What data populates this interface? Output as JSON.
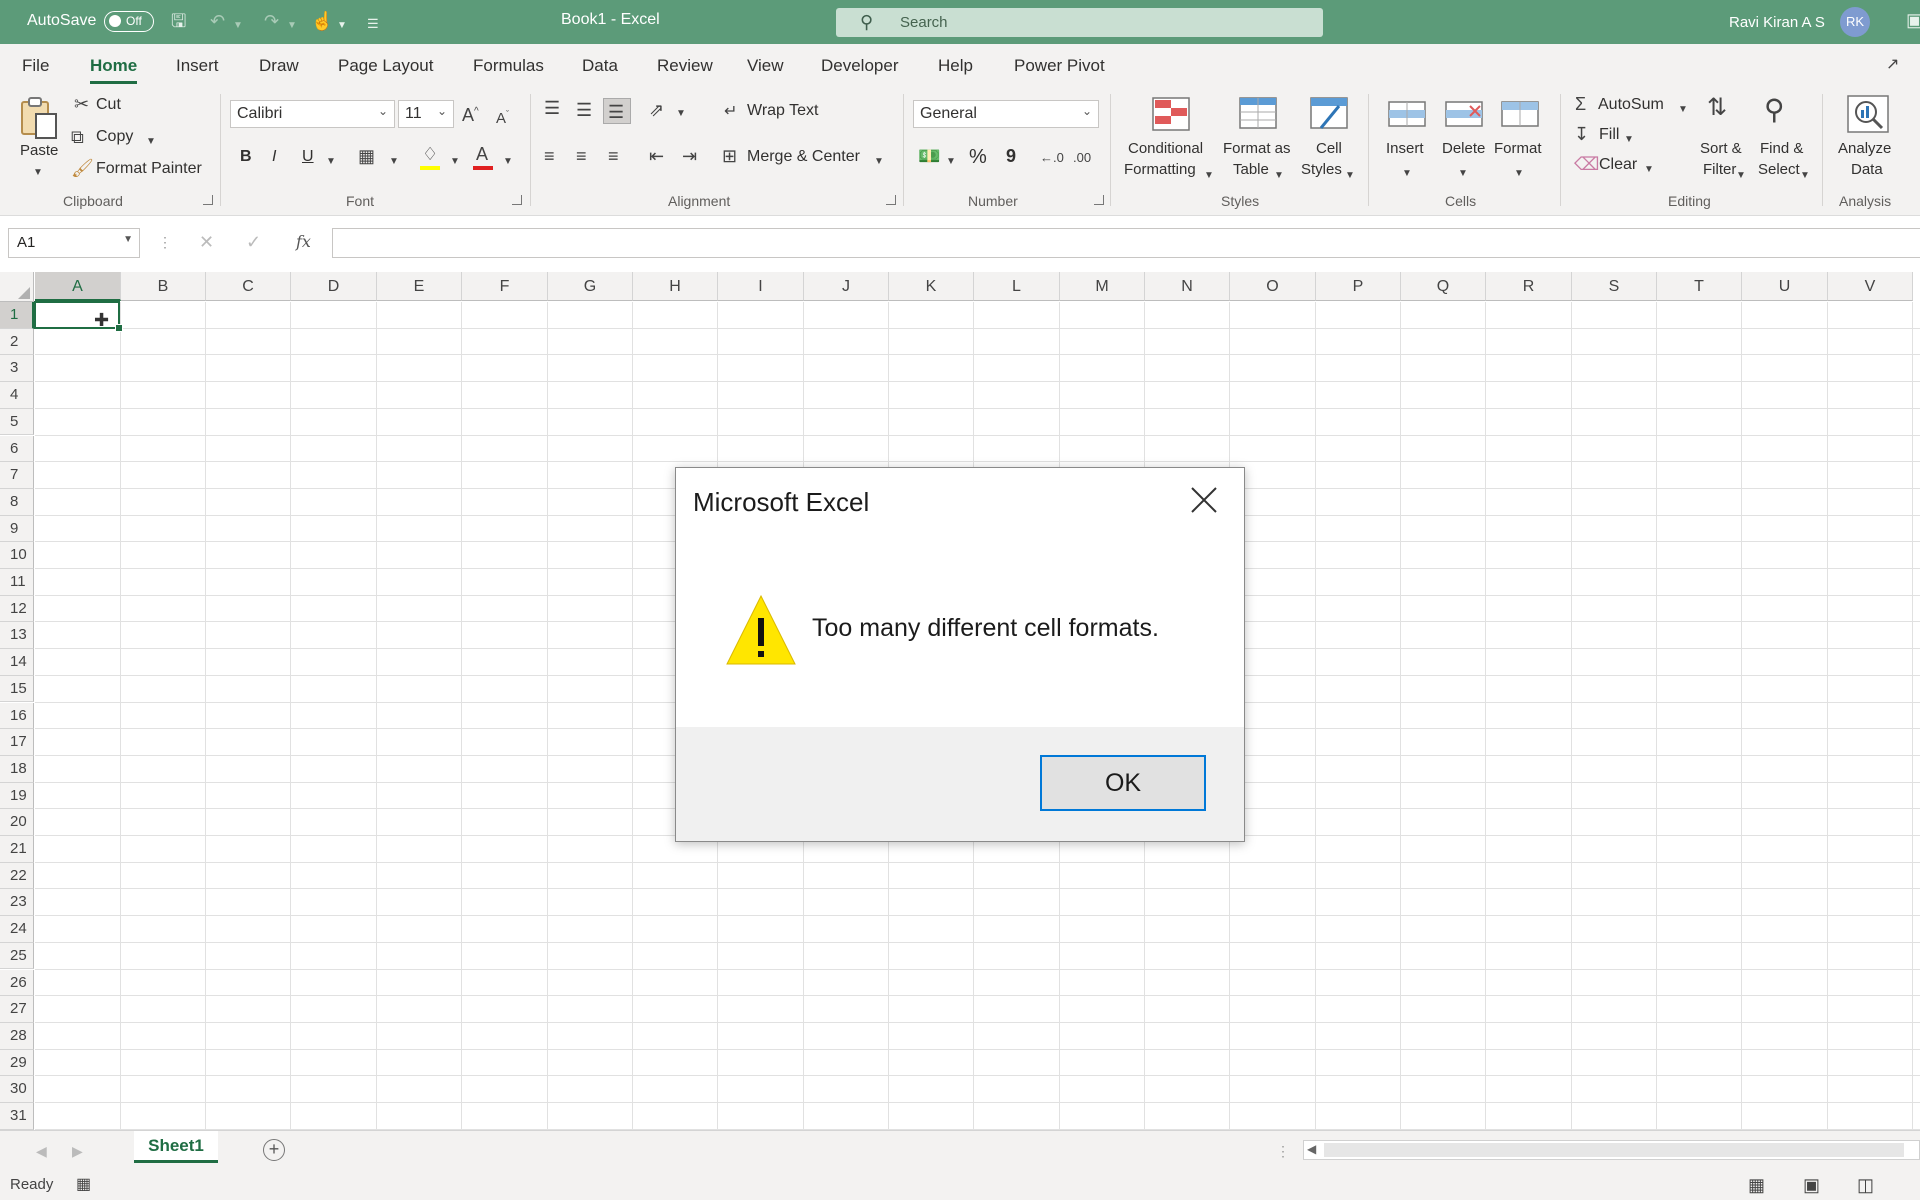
{
  "titlebar": {
    "autosave_label": "AutoSave",
    "autosave_state": "Off",
    "doc_title": "Book1  -  Excel",
    "search_placeholder": "Search",
    "user_name": "Ravi Kiran A S",
    "user_initials": "RK",
    "bar_color": "#5c9b79"
  },
  "tabs": [
    "File",
    "Home",
    "Insert",
    "Draw",
    "Page Layout",
    "Formulas",
    "Data",
    "Review",
    "View",
    "Developer",
    "Help",
    "Power Pivot"
  ],
  "active_tab": "Home",
  "ribbon": {
    "clipboard": {
      "paste": "Paste",
      "cut": "Cut",
      "copy": "Copy",
      "format_painter": "Format Painter",
      "label": "Clipboard"
    },
    "font": {
      "name": "Calibri",
      "size": "11",
      "bold": "B",
      "italic": "I",
      "underline": "U",
      "label": "Font"
    },
    "alignment": {
      "wrap_text": "Wrap Text",
      "merge_center": "Merge & Center",
      "label": "Alignment"
    },
    "number": {
      "format": "General",
      "percent": "%",
      "comma": "9",
      "label": "Number"
    },
    "styles": {
      "conditional_1": "Conditional",
      "conditional_2": "Formatting",
      "format_table_1": "Format as",
      "format_table_2": "Table",
      "cell_styles_1": "Cell",
      "cell_styles_2": "Styles",
      "label": "Styles"
    },
    "cells": {
      "insert": "Insert",
      "delete": "Delete",
      "format": "Format",
      "label": "Cells"
    },
    "editing": {
      "autosum": "AutoSum",
      "fill": "Fill",
      "clear": "Clear",
      "sort_1": "Sort &",
      "sort_2": "Filter",
      "find_1": "Find &",
      "find_2": "Select",
      "label": "Editing"
    },
    "analysis": {
      "analyze_1": "Analyze",
      "analyze_2": "Data",
      "label": "Analysis"
    }
  },
  "formula_bar": {
    "name_box": "A1",
    "fx": "fx",
    "content": ""
  },
  "grid": {
    "columns": [
      "A",
      "B",
      "C",
      "D",
      "E",
      "F",
      "G",
      "H",
      "I",
      "J",
      "K",
      "L",
      "M",
      "N",
      "O",
      "P",
      "Q",
      "R",
      "S",
      "T",
      "U",
      "V"
    ],
    "rows": [
      "1",
      "2",
      "3",
      "4",
      "5",
      "6",
      "7",
      "8",
      "9",
      "10",
      "11",
      "12",
      "13",
      "14",
      "15",
      "16",
      "17",
      "18",
      "19",
      "20",
      "21",
      "22",
      "23",
      "24",
      "25",
      "26",
      "27",
      "28",
      "29",
      "30",
      "31"
    ],
    "selected_cell": "A1"
  },
  "sheets": {
    "active": "Sheet1"
  },
  "status": {
    "text": "Ready"
  },
  "dialog": {
    "title": "Microsoft Excel",
    "message": "Too many different cell formats.",
    "ok_label": "OK",
    "icon": "warning-icon"
  }
}
